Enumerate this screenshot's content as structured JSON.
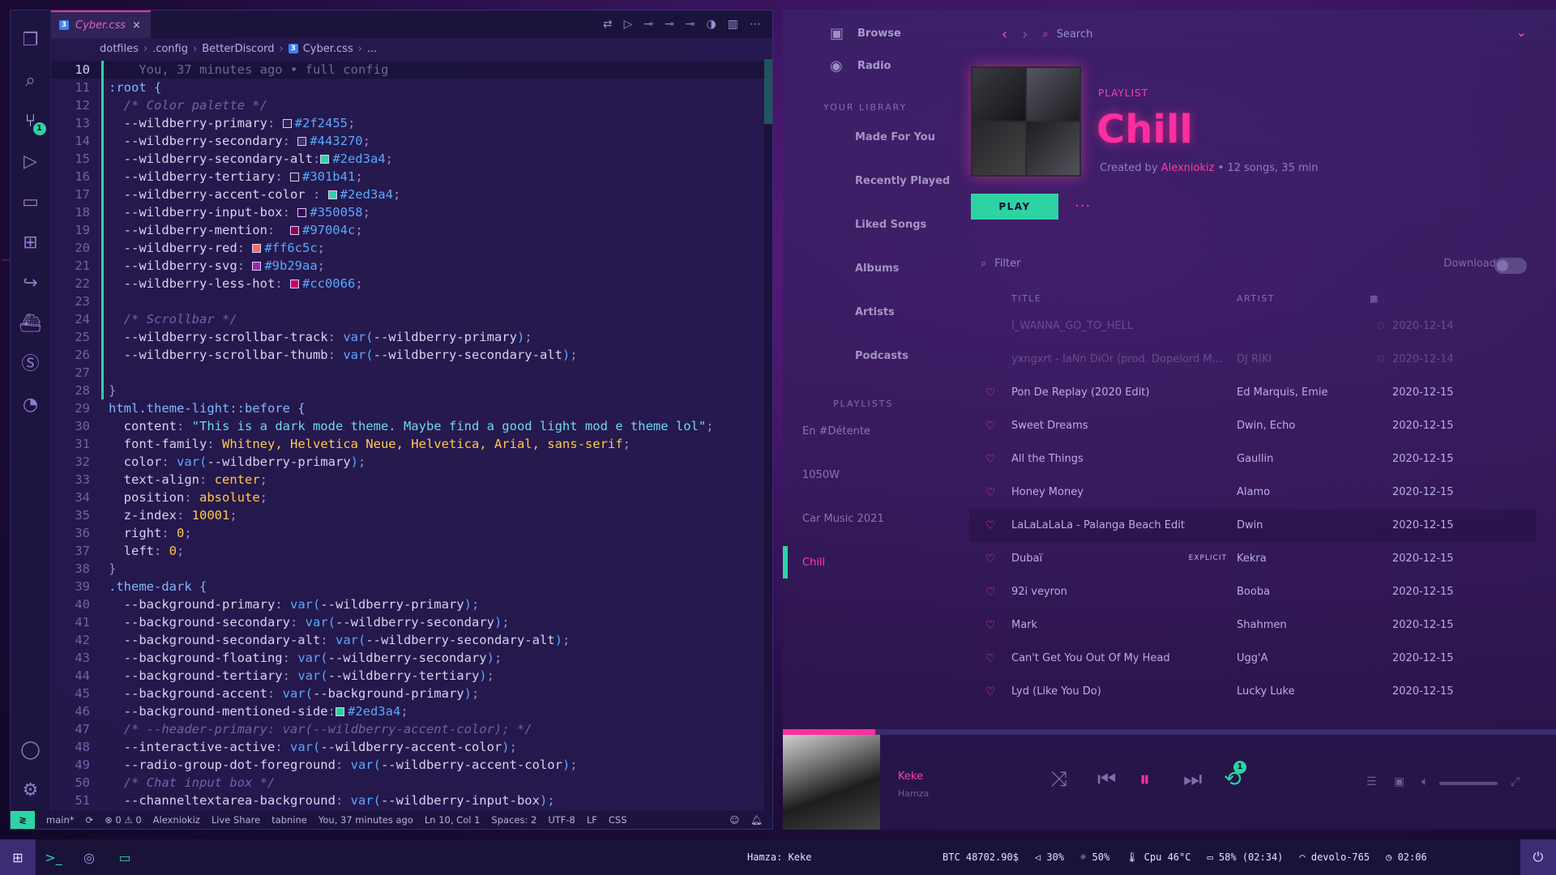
{
  "vscode": {
    "tab": {
      "filename": "Cyber.css",
      "close": "×"
    },
    "breadcrumb": [
      "dotfiles",
      ".config",
      "BetterDiscord",
      "Cyber.css",
      "..."
    ],
    "blame": "You, 37 minutes ago • full config",
    "lines": [
      {
        "n": "10",
        "cur": true
      },
      {
        "n": "11"
      },
      {
        "n": "12"
      },
      {
        "n": "13"
      },
      {
        "n": "14"
      },
      {
        "n": "15"
      },
      {
        "n": "16"
      },
      {
        "n": "17"
      },
      {
        "n": "18"
      },
      {
        "n": "19"
      },
      {
        "n": "20"
      },
      {
        "n": "21"
      },
      {
        "n": "22"
      },
      {
        "n": "23"
      },
      {
        "n": "24"
      },
      {
        "n": "25"
      },
      {
        "n": "26"
      },
      {
        "n": "27"
      },
      {
        "n": "28"
      },
      {
        "n": "29"
      },
      {
        "n": "30"
      },
      {
        "n": "31"
      },
      {
        "n": "32"
      },
      {
        "n": "33"
      },
      {
        "n": "34"
      },
      {
        "n": "35"
      },
      {
        "n": "36"
      },
      {
        "n": "37"
      },
      {
        "n": "38"
      },
      {
        "n": "39"
      },
      {
        "n": "40"
      },
      {
        "n": "41"
      },
      {
        "n": "42"
      },
      {
        "n": "43"
      },
      {
        "n": "44"
      },
      {
        "n": "45"
      },
      {
        "n": "46"
      },
      {
        "n": "47"
      },
      {
        "n": "48"
      },
      {
        "n": "49"
      },
      {
        "n": "50"
      },
      {
        "n": "51"
      }
    ],
    "code": {
      "l11": ":root {",
      "l12": "/* Color palette */",
      "l13": [
        "--wildberry-primary",
        "#2f2455"
      ],
      "l14": [
        "--wildberry-secondary",
        "#443270"
      ],
      "l15": [
        "--wildberry-secondary-alt",
        "#2ed3a4"
      ],
      "l16": [
        "--wildberry-tertiary",
        "#301b41"
      ],
      "l17": [
        "--wildberry-accent-color ",
        "#2ed3a4"
      ],
      "l18": [
        "--wildberry-input-box",
        "#350058"
      ],
      "l19": [
        "--wildberry-mention",
        "#97004c"
      ],
      "l20": [
        "--wildberry-red",
        "#ff6c5c"
      ],
      "l21": [
        "--wildberry-svg",
        "#9b29aa"
      ],
      "l22": [
        "--wildberry-less-hot",
        "#cc0066"
      ],
      "l24": "/* Scrollbar */",
      "l25": [
        "--wildberry-scrollbar-track",
        "--wildberry-primary"
      ],
      "l26": [
        "--wildberry-scrollbar-thumb",
        "--wildberry-secondary-alt"
      ],
      "l28": "}",
      "l29": "html.theme-light::before {",
      "l30": [
        "content",
        "\"This is a dark mode theme. Maybe find a good light mod e theme lol\""
      ],
      "l31": [
        "font-family",
        "Whitney, Helvetica Neue, Helvetica, Arial, sans-serif"
      ],
      "l32": [
        "color",
        "--wildberry-primary"
      ],
      "l33": [
        "text-align",
        "center"
      ],
      "l34": [
        "position",
        "absolute"
      ],
      "l35": [
        "z-index",
        "10001"
      ],
      "l36": [
        "right",
        "0"
      ],
      "l37": [
        "left",
        "0"
      ],
      "l38": "}",
      "l39": ".theme-dark {",
      "l40": [
        "--background-primary",
        "--wildberry-primary"
      ],
      "l41": [
        "--background-secondary",
        "--wildberry-secondary"
      ],
      "l42": [
        "--background-secondary-alt",
        "--wildberry-secondary-alt"
      ],
      "l43": [
        "--background-floating",
        "--wildberry-secondary"
      ],
      "l44": [
        "--background-tertiary",
        "--wildberry-tertiary"
      ],
      "l45": [
        "--background-accent",
        "--background-primary"
      ],
      "l46": [
        "--background-mentioned-side",
        "#2ed3a4"
      ],
      "l47": "/* --header-primary: var(--wildberry-accent-color); */",
      "l48": [
        "--interactive-active",
        "--wildberry-accent-color"
      ],
      "l49": [
        "--radio-group-dot-foreground",
        "--wildberry-accent-color"
      ],
      "l50": "/* Chat input box */",
      "l51": [
        "--channeltextarea-background",
        "--wildberry-input-box"
      ]
    },
    "status": {
      "branch": "main*",
      "sync": "⟳",
      "problems": "⊗ 0 ⚠ 0",
      "user": "Alexniokiz",
      "liveshare": "Live Share",
      "tabnine": "tabnine",
      "blame": "You, 37 minutes ago",
      "position": "Ln 10, Col 1",
      "spaces": "Spaces: 2",
      "encoding": "UTF-8",
      "eol": "LF",
      "lang": "CSS"
    }
  },
  "spotify": {
    "nav": {
      "browse": "Browse",
      "radio": "Radio"
    },
    "library_head": "YOUR LIBRARY",
    "library": [
      "Made For You",
      "Recently Played",
      "Liked Songs",
      "Albums",
      "Artists",
      "Podcasts"
    ],
    "playlists_head": "PLAYLISTS",
    "playlists": [
      "En #Détente",
      "1050W",
      "Car Music 2021",
      "Chill"
    ],
    "search_placeholder": "Search",
    "playlist": {
      "type": "PLAYLIST",
      "title": "Chill",
      "created_by": "Created by",
      "owner": "Alexniokiz",
      "stats": "• 12 songs, 35 min",
      "play": "PLAY",
      "more": "···",
      "filter": "Filter",
      "download": "Download"
    },
    "columns": {
      "title": "TITLE",
      "artist": "ARTIST"
    },
    "tracks": [
      {
        "title": "I_WANNA_GO_TO_HELL",
        "artist": "",
        "date": "2020-12-14",
        "dim": true
      },
      {
        "title": "yxngxrt - IaNn DiOr (prod. Dopelord M...",
        "artist": "DJ RIKI",
        "date": "2020-12-14",
        "dim": true
      },
      {
        "title": "Pon De Replay (2020 Edit)",
        "artist": "Ed Marquis, Emie",
        "date": "2020-12-15"
      },
      {
        "title": "Sweet Dreams",
        "artist": "Dwin, Echo",
        "date": "2020-12-15"
      },
      {
        "title": "All the Things",
        "artist": "Gaullin",
        "date": "2020-12-15"
      },
      {
        "title": "Honey Money",
        "artist": "Alamo",
        "date": "2020-12-15"
      },
      {
        "title": "LaLaLaLaLa - Palanga Beach Edit",
        "artist": "Dwin",
        "date": "2020-12-15",
        "hl": true
      },
      {
        "title": "Dubaï",
        "artist": "Kekra",
        "date": "2020-12-15",
        "explicit": "EXPLICIT"
      },
      {
        "title": "92i veyron",
        "artist": "Booba",
        "date": "2020-12-15"
      },
      {
        "title": "Mark",
        "artist": "Shahmen",
        "date": "2020-12-15"
      },
      {
        "title": "Can't Get You Out Of My Head",
        "artist": "Ugg'A",
        "date": "2020-12-15"
      },
      {
        "title": "Lyd (Like You Do)",
        "artist": "Lucky Luke",
        "date": "2020-12-15"
      }
    ],
    "now_playing": {
      "title": "Keke",
      "artist": "Hamza",
      "progress": 0.12,
      "repeat_badge": "1"
    }
  },
  "taskbar": {
    "now_playing": "Hamza: Keke",
    "btc": "BTC 48702.90$",
    "volume": "30%",
    "brightness": "50%",
    "cpu": "Cpu 46°C",
    "battery": "58% (02:34)",
    "wifi": "devolo-765",
    "clock": "02:06"
  },
  "colors": {
    "accent_pink": "#ff2e9e",
    "accent_teal": "#2ed3a4",
    "bg": "#251a4e"
  }
}
